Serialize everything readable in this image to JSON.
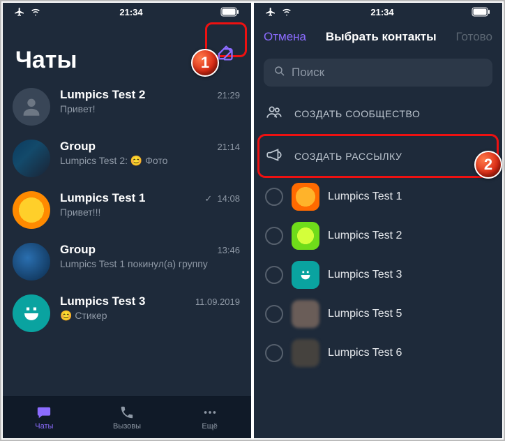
{
  "status": {
    "time": "21:34",
    "time_right": "21:34"
  },
  "left": {
    "title": "Чаты",
    "chats": [
      {
        "name": "Lumpics Test 2",
        "preview": "Привет!",
        "time": "21:29"
      },
      {
        "name": "Group",
        "preview": "Lumpics Test 2: 😊 Фото",
        "time": "21:14"
      },
      {
        "name": "Lumpics Test 1",
        "preview": "Привет!!!",
        "time": "14:08",
        "check": "✓"
      },
      {
        "name": "Group",
        "preview": "Lumpics Test 1 покинул(а) группу",
        "time": "13:46"
      },
      {
        "name": "Lumpics Test 3",
        "preview": "😊 Стикер",
        "time": "11.09.2019"
      }
    ],
    "tabs": {
      "chats": "Чаты",
      "calls": "Вызовы",
      "more": "Ещё"
    }
  },
  "right": {
    "cancel": "Отмена",
    "title": "Выбрать контакты",
    "done": "Готово",
    "search_placeholder": "Поиск",
    "option_community": "СОЗДАТЬ СООБЩЕСТВО",
    "option_broadcast": "СОЗДАТЬ РАССЫЛКУ",
    "contacts": [
      {
        "name": "Lumpics Test 1"
      },
      {
        "name": "Lumpics Test 2"
      },
      {
        "name": "Lumpics Test 3"
      },
      {
        "name": "Lumpics Test 5"
      },
      {
        "name": "Lumpics Test 6"
      }
    ]
  },
  "badges": {
    "one": "1",
    "two": "2"
  }
}
